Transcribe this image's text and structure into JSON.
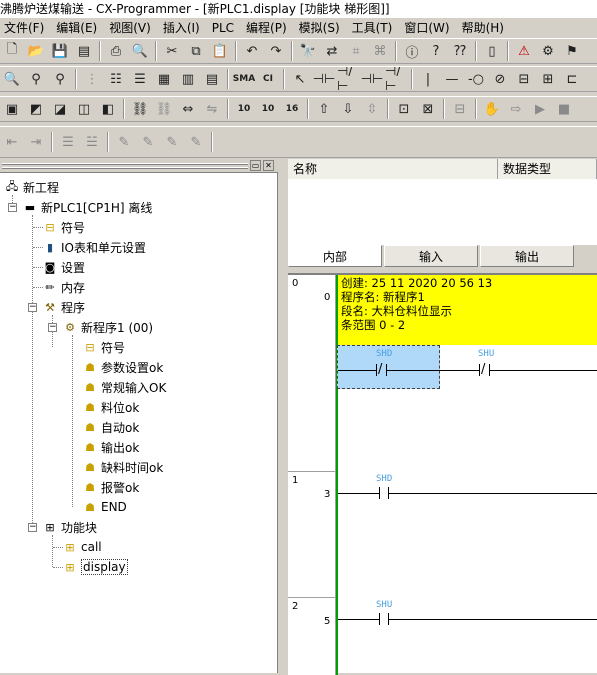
{
  "window": {
    "title": "沸腾炉送煤输送 - CX-Programmer - [新PLC1.display [功能块 梯形图]]"
  },
  "menu": {
    "items": [
      "文件(F)",
      "编辑(E)",
      "视图(V)",
      "插入(I)",
      "PLC",
      "编程(P)",
      "模拟(S)",
      "工具(T)",
      "窗口(W)",
      "帮助(H)"
    ]
  },
  "toolbar4": {
    "buttons": [
      "10",
      "10",
      "16"
    ]
  },
  "tree": {
    "root": "新工程",
    "plc": "新PLC1[CP1H] 离线",
    "symbols": "符号",
    "io_table": "IO表和单元设置",
    "settings": "设置",
    "memory": "内存",
    "programs": "程序",
    "program1": "新程序1 (00)",
    "sections": [
      "符号",
      "参数设置ok",
      "常规输入OK",
      "料位ok",
      "自动ok",
      "输出ok",
      "缺料时间ok",
      "报警ok",
      "END"
    ],
    "function_blocks": "功能块",
    "fb_items": [
      "call",
      "display"
    ]
  },
  "symbol_table": {
    "col_name": "名称",
    "col_type": "数据类型",
    "tabs": [
      "内部",
      "输入",
      "输出"
    ]
  },
  "ladder": {
    "comment": [
      "创建: 25 11 2020 20 56 13",
      "程序名: 新程序1",
      "段名: 大料仓料位显示",
      "条范围 0 - 2"
    ],
    "rungs": [
      {
        "rung": "0",
        "step": "0"
      },
      {
        "rung": "1",
        "step": "3"
      },
      {
        "rung": "2",
        "step": "5"
      }
    ],
    "contacts": [
      "SHD",
      "SHU",
      "SHD",
      "SHU"
    ]
  },
  "colors": {
    "comment_bg": "#ffff00",
    "power_rail": "#00a000",
    "selection": "#b0d8f8",
    "operand": "#4aa0e0"
  }
}
